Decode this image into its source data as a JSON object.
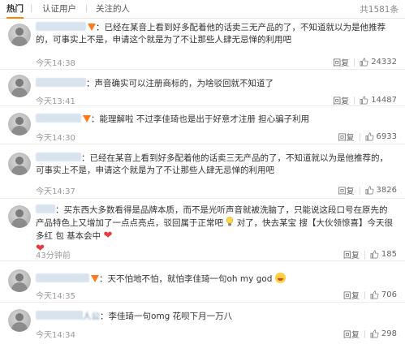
{
  "tabs": {
    "items": [
      "热门",
      "认证用户",
      "关注的人"
    ],
    "separator": "|",
    "total": "共1581条"
  },
  "actions": {
    "reply": "回复"
  },
  "comments": [
    {
      "text": "：已经在某音上看到好多配着他的话卖三无产品的了，不知道就以为是他推荐的，可事实上不是，申请这个就是为了不让那些人肆无忌惮的利用吧",
      "time": "今天14:38",
      "likes": "24332"
    },
    {
      "text": "：声音确实可以注册商标的，为啥驳回就不知道了",
      "time": "今天13:41",
      "likes": "14487"
    },
    {
      "text": "：能理解啦 不过李佳琦也是出于好意才注册 担心骗子利用",
      "time": "今天14:30",
      "likes": "6933"
    },
    {
      "text": "：已经在某音上看到好多配着他的话卖三无产品的了，不知道就以为是他推荐的，可事实上不是，申请这个就是为了不让那些人肆无忌惮的利用吧",
      "time": "今天14:37",
      "likes": "3826"
    },
    {
      "text_a": "：买东西大多数看得是品牌本质，而不是光听声音就被洗脑了，只能说这段口号在原先的产品特色上又增加了一点点亮点，驳回属于正常吧",
      "text_b": "对了，快去某宝 搜【大伙领惊喜】今天很多红 包 基本会中",
      "time": "43分钟前",
      "likes": "185"
    },
    {
      "text": "：天不怕地不怕，就怕李佳琦一句oh my god",
      "time": "今天14:35",
      "likes": "706"
    },
    {
      "username_tail": "人公",
      "text": "：李佳琦一句omg 花呗下月一万八",
      "time": "今天14:34",
      "likes": "298"
    }
  ],
  "colors": {
    "accent": "#ff8200",
    "vip_badge": "#ff7a1a",
    "heart": "#e8383d"
  },
  "icons": [
    "vip-badge-icon",
    "thumb-up-icon",
    "heart-icon",
    "grin-emoji-icon",
    "lightbulb-icon"
  ]
}
